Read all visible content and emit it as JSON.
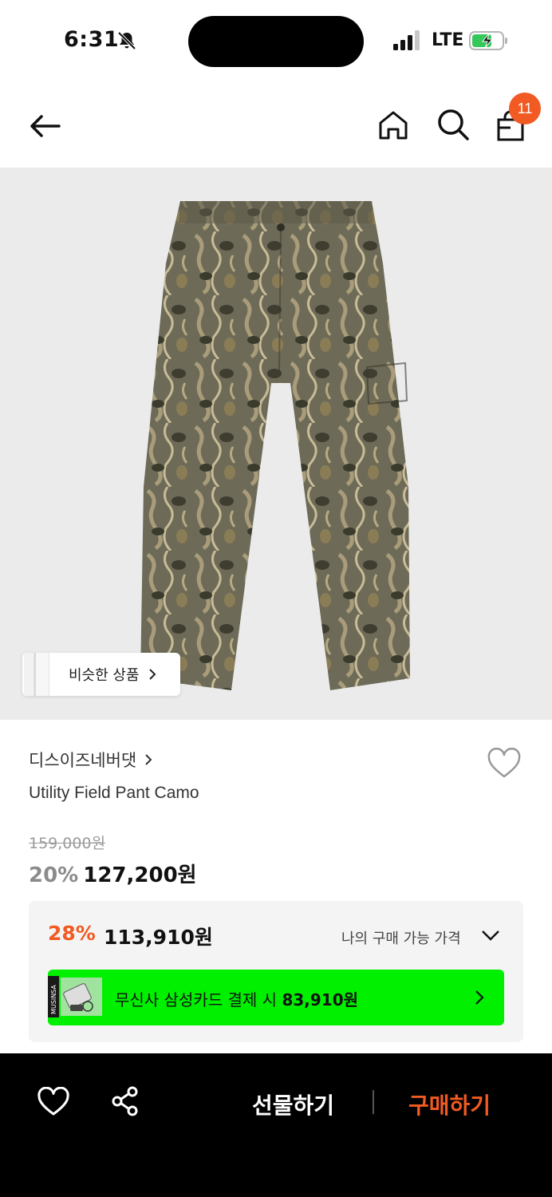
{
  "status_bar": {
    "time": "6:31",
    "network": "LTE"
  },
  "nav": {
    "cart_count": "11"
  },
  "product": {
    "similar_label": "비슷한 상품",
    "brand": "디스이즈네버댓",
    "name": "Utility Field Pant Camo",
    "original_price": "159,000원",
    "discount": "20%",
    "price": "127,200원"
  },
  "my_price": {
    "discount": "28%",
    "price": "113,910원",
    "label": "나의 구매 가능 가격"
  },
  "card_promo": {
    "text": "무신사 삼성카드 결제 시",
    "price": "83,910원",
    "card_brand": "MUSINSA"
  },
  "bottom_bar": {
    "gift_label": "선물하기",
    "buy_label": "구매하기"
  },
  "colors": {
    "accent": "#f15a22",
    "promo_green": "#00f000",
    "image_bg": "#ebebeb"
  }
}
